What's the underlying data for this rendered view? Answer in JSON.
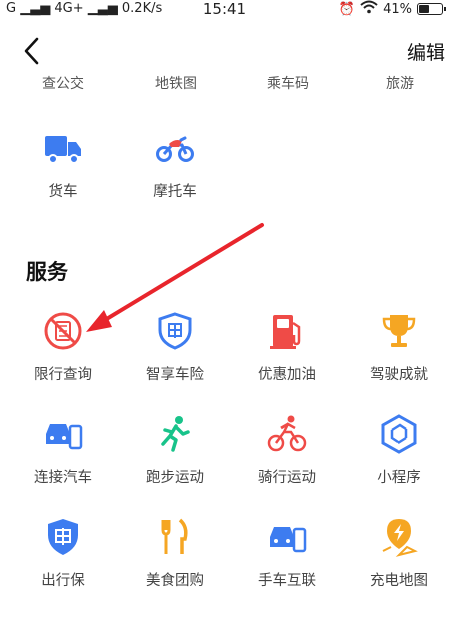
{
  "status_bar": {
    "signal_left": "G",
    "network": "4G+",
    "speed": "0.2K/s",
    "time": "15:41",
    "battery": "41%",
    "battery_level": 0.41
  },
  "header": {
    "edit_label": "编辑"
  },
  "partial_row": [
    "查公交",
    "地铁图",
    "乘车码",
    "旅游"
  ],
  "vehicles": [
    {
      "label": "货车",
      "icon": "truck-icon"
    },
    {
      "label": "摩托车",
      "icon": "motorcycle-icon"
    }
  ],
  "services": {
    "title": "服务",
    "items": [
      {
        "label": "限行查询",
        "icon": "restriction-icon"
      },
      {
        "label": "智享车险",
        "icon": "insurance-shield-icon"
      },
      {
        "label": "优惠加油",
        "icon": "fuel-pump-icon"
      },
      {
        "label": "驾驶成就",
        "icon": "trophy-icon"
      },
      {
        "label": "连接汽车",
        "icon": "car-phone-icon"
      },
      {
        "label": "跑步运动",
        "icon": "runner-icon"
      },
      {
        "label": "骑行运动",
        "icon": "cyclist-icon"
      },
      {
        "label": "小程序",
        "icon": "mini-program-icon"
      },
      {
        "label": "出行保",
        "icon": "travel-insurance-icon"
      },
      {
        "label": "美食团购",
        "icon": "fork-knife-icon"
      },
      {
        "label": "手车互联",
        "icon": "car-phone-link-icon"
      },
      {
        "label": "充电地图",
        "icon": "charging-map-icon"
      }
    ]
  },
  "colors": {
    "blue": "#3d7cf0",
    "red": "#ef4b47",
    "orange": "#f5a623",
    "green": "#18c38a",
    "arrow": "#e8252c"
  }
}
